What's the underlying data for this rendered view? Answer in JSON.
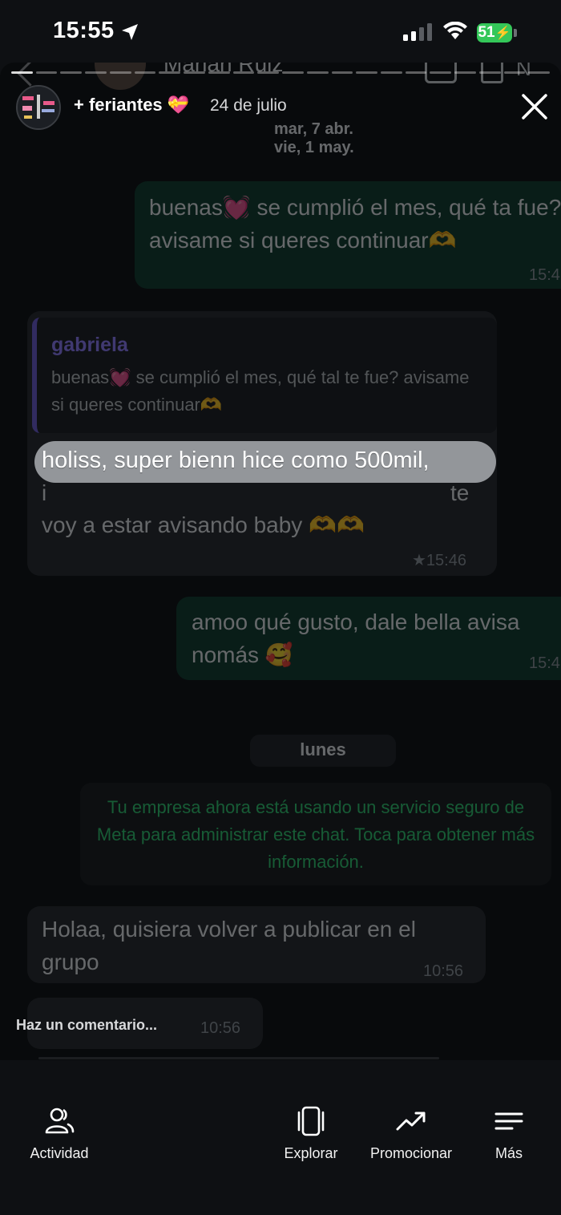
{
  "status_bar": {
    "time": "15:55",
    "battery": "51"
  },
  "story": {
    "group_name": "+ feriantes",
    "group_emoji": "💝",
    "date": "24 de julio"
  },
  "chat": {
    "contact_name": "Marian Ruiz",
    "date_separators": [
      "mar, 7 abr.",
      "vie, 1 may."
    ],
    "msg1_text": "buenas💓 se cumplió el mes, qué ta fue? avisame si queres continuar🫶",
    "msg1_time": "15:4",
    "quote_author": "gabriela",
    "quote_text": "buenas💓 se cumplió el mes, qué tal te fue? avisame si queres continuar🫶",
    "reply_line1": "holiss, super bienn hice como 500mil,",
    "reply_line2_fragment": "te",
    "reply_line3": "voy a estar avisando baby 🫶🫶",
    "reply_time": "★15:46",
    "msg3_text": "amoo qué gusto, dale bella avisa nomás 🥰",
    "msg3_time": "15:4",
    "day_label": "lunes",
    "system_notice": "Tu empresa ahora está usando un servicio seguro de Meta para administrar este chat. Toca para obtener más información.",
    "msg4_text": "Holaa, quisiera volver a publicar en el grupo",
    "msg4_time": "10:56",
    "msg5_time": "10:56"
  },
  "comment_placeholder": "Haz un comentario...",
  "bottom_nav": [
    {
      "label": "Actividad",
      "icon": "people-icon"
    },
    {
      "label": "Explorar",
      "icon": "cards-icon"
    },
    {
      "label": "Promocionar",
      "icon": "trending-up-icon"
    },
    {
      "label": "Más",
      "icon": "menu-icon"
    }
  ]
}
